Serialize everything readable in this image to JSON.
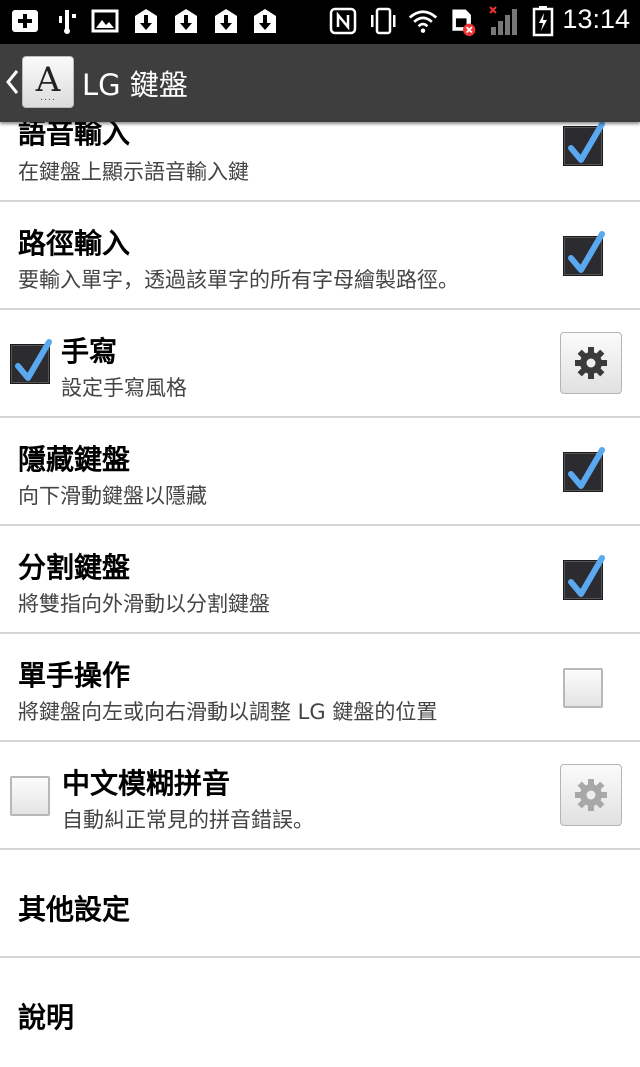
{
  "status_bar": {
    "time": "13:14",
    "icons": [
      "add-icon",
      "usb-icon",
      "image-icon",
      "download-icon",
      "download-icon",
      "download-icon",
      "download-icon",
      "nfc-icon",
      "vibrate-icon",
      "wifi-icon",
      "sim-error-icon",
      "signal-icon",
      "battery-charging-icon"
    ]
  },
  "action_bar": {
    "title": "LG 鍵盤",
    "icon_glyph": "A",
    "icon_dots": "...."
  },
  "settings": {
    "voice_input": {
      "title": "語音輸入",
      "summary": "在鍵盤上顯示語音輸入鍵",
      "checked": true
    },
    "path_input": {
      "title": "路徑輸入",
      "summary": "要輸入單字，透過該單字的所有字母繪製路徑。",
      "checked": true
    },
    "handwriting": {
      "title": "手寫",
      "summary": "設定手寫風格",
      "checked": true
    },
    "hide_keyboard": {
      "title": "隱藏鍵盤",
      "summary": "向下滑動鍵盤以隱藏",
      "checked": true
    },
    "split_keyboard": {
      "title": "分割鍵盤",
      "summary": "將雙指向外滑動以分割鍵盤",
      "checked": true
    },
    "one_hand": {
      "title": "單手操作",
      "summary": "將鍵盤向左或向右滑動以調整 LG 鍵盤的位置",
      "checked": false
    },
    "fuzzy_pinyin": {
      "title": "中文模糊拼音",
      "summary": "自動糾正常見的拼音錯誤。",
      "checked": false
    },
    "other_settings": {
      "title": "其他設定"
    },
    "help": {
      "title": "說明"
    }
  },
  "colors": {
    "action_bar": "#3e3e3e",
    "check_accent": "#5aa8f0",
    "divider": "#d6d6d6"
  }
}
